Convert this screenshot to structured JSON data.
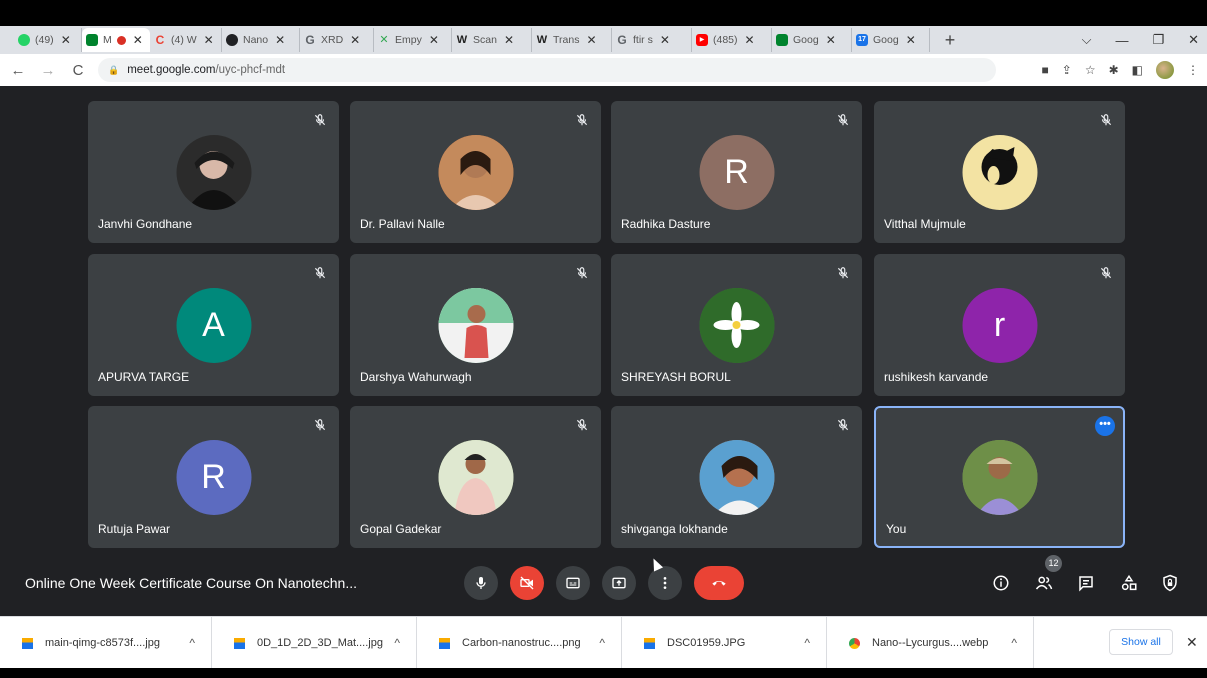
{
  "browser": {
    "tabs": [
      {
        "title": "(49)",
        "icon": "whatsapp-icon",
        "color": "#25d366",
        "glyph": ""
      },
      {
        "title": "M",
        "icon": "meet-icon",
        "color": "#00832d",
        "glyph": "",
        "recording": true,
        "active": true
      },
      {
        "title": "(4) W",
        "icon": "google-classroom-icon",
        "color": "#ea4335",
        "glyph": "C"
      },
      {
        "title": "Nano",
        "icon": "site-icon",
        "color": "#202124",
        "glyph": "◐"
      },
      {
        "title": "XRD",
        "icon": "google-icon",
        "color": "#5f6368",
        "glyph": "G"
      },
      {
        "title": "Empy",
        "icon": "tool-icon",
        "color": "#34a853",
        "glyph": "✕"
      },
      {
        "title": "Scan",
        "icon": "wikipedia-icon",
        "color": "#fff",
        "glyph": "W"
      },
      {
        "title": "Trans",
        "icon": "wikipedia-icon",
        "color": "#fff",
        "glyph": "W"
      },
      {
        "title": "ftir s",
        "icon": "google-icon",
        "color": "#5f6368",
        "glyph": "G"
      },
      {
        "title": "(485)",
        "icon": "youtube-icon",
        "color": "#ff0000",
        "glyph": "▶"
      },
      {
        "title": "Goog",
        "icon": "meet-icon",
        "color": "#00832d",
        "glyph": ""
      },
      {
        "title": "Goog",
        "icon": "calendar-icon",
        "color": "#1a73e8",
        "glyph": "17"
      }
    ],
    "new_tab": "+",
    "url_host": "meet.google.com",
    "url_path": "/uyc-phcf-mdt"
  },
  "meeting": {
    "title": "Online One Week Certificate Course On Nanotechn...",
    "participant_count": "12",
    "participants": [
      {
        "name": "Janvhi Gondhane",
        "avatar": "photo",
        "color": "#2b2b2b",
        "initial": ""
      },
      {
        "name": "Dr. Pallavi Nalle",
        "avatar": "photo",
        "color": "#a0522d",
        "initial": ""
      },
      {
        "name": "Radhika Dasture",
        "avatar": "initial",
        "color": "#8d6e63",
        "initial": "R"
      },
      {
        "name": "Vitthal Mujmule",
        "avatar": "photo",
        "color": "#f3e3a3",
        "initial": ""
      },
      {
        "name": "APURVA TARGE",
        "avatar": "initial",
        "color": "#00897b",
        "initial": "A"
      },
      {
        "name": "Darshya Wahurwagh",
        "avatar": "photo",
        "color": "#4caf7a",
        "initial": ""
      },
      {
        "name": "SHREYASH BORUL",
        "avatar": "photo",
        "color": "#3e7d3a",
        "initial": ""
      },
      {
        "name": "rushikesh karvande",
        "avatar": "initial",
        "color": "#8e24aa",
        "initial": "r"
      },
      {
        "name": "Rutuja Pawar",
        "avatar": "initial",
        "color": "#5c6bc0",
        "initial": "R"
      },
      {
        "name": "Gopal Gadekar",
        "avatar": "photo",
        "color": "#8fb36c",
        "initial": ""
      },
      {
        "name": "shivganga lokhande",
        "avatar": "photo",
        "color": "#c07a55",
        "initial": ""
      },
      {
        "name": "You",
        "avatar": "photo",
        "color": "#7a9b55",
        "initial": ""
      }
    ]
  },
  "downloads": {
    "items": [
      {
        "name": "main-qimg-c8573f....jpg",
        "color": "#1a73e8"
      },
      {
        "name": "0D_1D_2D_3D_Mat....jpg",
        "color": "#1a73e8"
      },
      {
        "name": "Carbon-nanostruc....png",
        "color": "#1a73e8"
      },
      {
        "name": "DSC01959.JPG",
        "color": "#1a73e8"
      },
      {
        "name": "Nano--Lycurgus....webp",
        "color": "#ea4335"
      }
    ],
    "show_all": "Show all"
  }
}
